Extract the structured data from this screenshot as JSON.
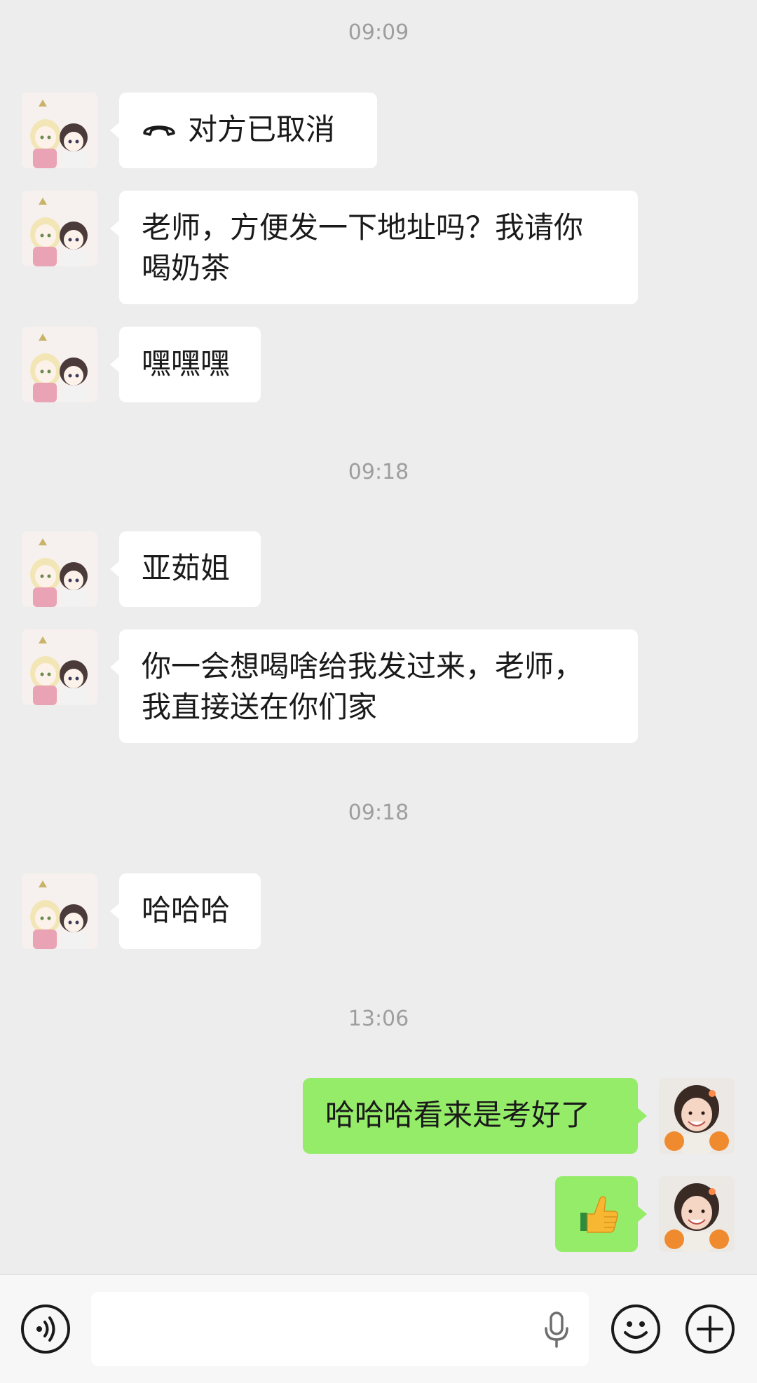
{
  "timestamps": [
    "09:09",
    "09:18",
    "09:18",
    "13:06"
  ],
  "messages": {
    "m1": "对方已取消",
    "m2_line1": "老师，方便发一下地址吗？我请你",
    "m2_line2": "喝奶茶",
    "m3": "嘿嘿嘿",
    "m4": "亚茹姐",
    "m5_line1": "你一会想喝啥给我发过来，老师，",
    "m5_line2": "我直接送在你们家",
    "m6": "哈哈哈",
    "m7": "哈哈哈看来是考好了"
  },
  "icons": {
    "call": "phone-hangup-icon",
    "thumb": "thumbs-up-emoji",
    "voice": "voice-icon",
    "mic": "microphone-icon",
    "emoji": "smiley-icon",
    "plus": "plus-icon"
  },
  "colors": {
    "background": "#ededed",
    "incoming_bubble": "#ffffff",
    "outgoing_bubble": "#95ec69",
    "timestamp": "#9e9e9e",
    "input_bar": "#f7f7f7"
  },
  "input": {
    "value": "",
    "placeholder": ""
  }
}
